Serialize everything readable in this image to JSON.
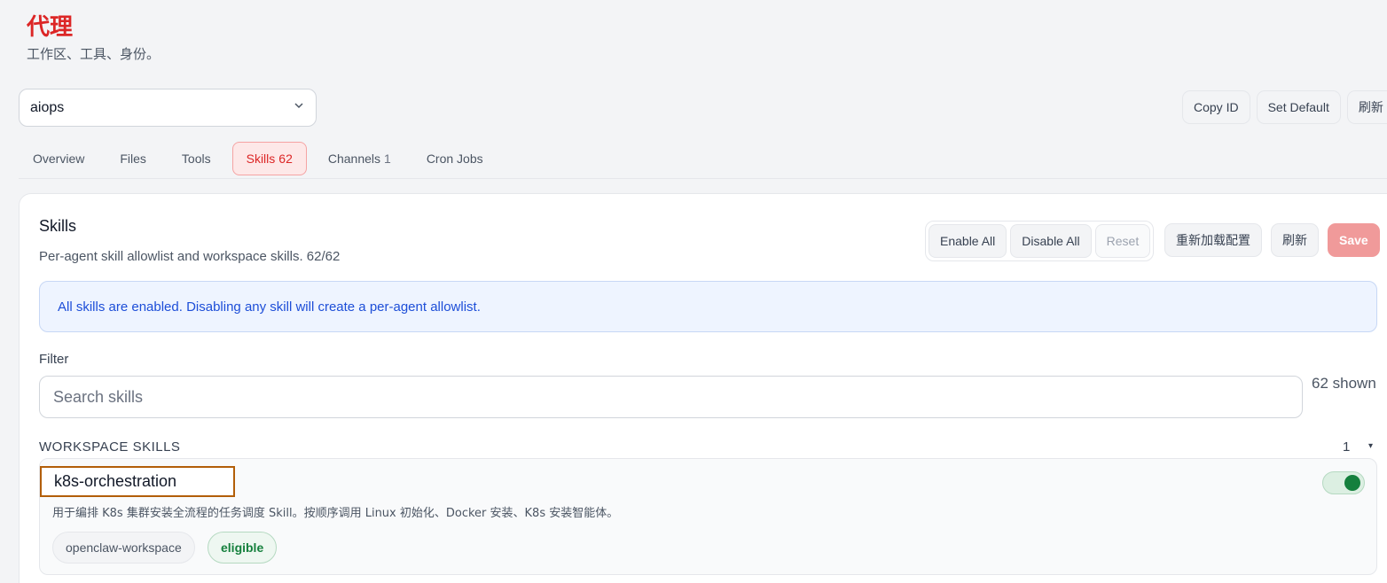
{
  "header": {
    "title": "代理",
    "subtitle": "工作区、工具、身份。"
  },
  "agent_select": {
    "value": "aiops",
    "icon": "chevron-down-icon"
  },
  "top_actions": {
    "copy_id": "Copy ID",
    "set_default": "Set Default",
    "refresh": "刷新"
  },
  "tabs": [
    {
      "label": "Overview",
      "count": ""
    },
    {
      "label": "Files",
      "count": ""
    },
    {
      "label": "Tools",
      "count": ""
    },
    {
      "label": "Skills",
      "count": "62"
    },
    {
      "label": "Channels",
      "count": "1"
    },
    {
      "label": "Cron Jobs",
      "count": ""
    }
  ],
  "skills_panel": {
    "title": "Skills",
    "subtitle": "Per-agent skill allowlist and workspace skills. 62/62",
    "enable_all": "Enable All",
    "disable_all": "Disable All",
    "reset": "Reset",
    "reload_config": "重新加载配置",
    "refresh": "刷新",
    "save": "Save",
    "info": "All skills are enabled. Disabling any skill will create a per-agent allowlist.",
    "filter_label": "Filter",
    "search_placeholder": "Search skills",
    "shown_count": "62 shown",
    "section": {
      "title": "WORKSPACE SKILLS",
      "count": "1",
      "caret": "▾"
    },
    "skills": [
      {
        "name": "k8s-orchestration",
        "description": "用于编排 K8s 集群安装全流程的任务调度 Skill。按顺序调用 Linux 初始化、Docker 安装、K8s 安装智能体。",
        "source": "openclaw-workspace",
        "status": "eligible",
        "enabled": true
      }
    ]
  },
  "colors": {
    "accent": "#dc2626",
    "info_text": "#1d4ed8",
    "toggle_on": "#15803d"
  }
}
